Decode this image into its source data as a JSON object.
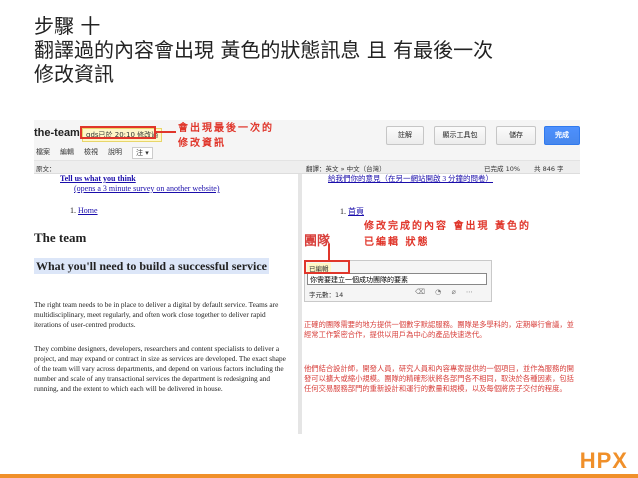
{
  "heading": {
    "line1": "步驟 十",
    "line2": "翻譯過的內容會出現 黃色的狀態訊息 且 有最後一次",
    "line3": "修改資訊"
  },
  "toolbar": {
    "doc_title": "the-team",
    "status_text": "gds已於 20:10 修改過",
    "menu": [
      "檔案",
      "編輯",
      "檢視",
      "說明"
    ],
    "menu_dropdown": "注 ▾",
    "buttons": {
      "comment": "註解",
      "show_toolkit": "顯示工具包",
      "save": "儲存",
      "done": "完成"
    }
  },
  "annotations": {
    "top_line1": "會出現最後一次的",
    "top_line2": "修改資訊",
    "mid_line1": "修改完成的內容 會出現 黃色的",
    "mid_line2": "已編輯 狀態"
  },
  "langbar": {
    "source_label": "原文：",
    "translate_label": "翻譯：英文 » 中文（台灣）",
    "completed": "已完成 10%",
    "total": "共 846 字"
  },
  "source": {
    "tell_us": "Tell us what you think",
    "survey": "(opens a 3 minute survey on another website)",
    "home": "Home",
    "team_heading": "The team",
    "what_heading": "What you'll need to build a successful service",
    "para1": "The right team needs to be in place to deliver a digital by default service. Teams are multidisciplinary, meet regularly, and often work close together to deliver rapid iterations of user-centred products.",
    "para2": "They combine designers, developers, researchers and content specialists to deliver a project, and may expand or contract in size as services are developed. The exact shape of the team will vary across departments, and depend on various factors including the number and scale of any transactional services the department is redesigning and running, and the extent to which each will be delivered in house."
  },
  "translation": {
    "top_line": "給我們你的意見（在另一網站開啟 3 分鐘的問卷）",
    "home": "首頁",
    "team_heading": "團隊",
    "para1": "正確的團隊需要的地方提供一個數字默認服務。團隊是多學科的，定期舉行會議，並經常工作緊密合作，提供以用戶為中心的產品快速迭代。",
    "para2": "他們結合設計師，開發人員，研究人員和內容專家提供的一個項目，並作為服務的開發可以擴大或縮小規模。團隊的精確形狀將各部門各不相同，取決於各種因素，包括任何交易服務部門的重新設計和運行的數量和規模，以及每個將房子交付的程度。"
  },
  "editor": {
    "status": "已編輯",
    "input_value": "你需要建立一個成功團隊的要素",
    "char_count": "字元數：14",
    "tool_icons": "⌫ ◔ ⌀ ⋯"
  },
  "logo": "HPX",
  "colors": {
    "accent_red": "#e0362b",
    "done_button": "#4d90fe",
    "yellow_status": "#fff7c8",
    "logo_orange": "#f0902a"
  }
}
